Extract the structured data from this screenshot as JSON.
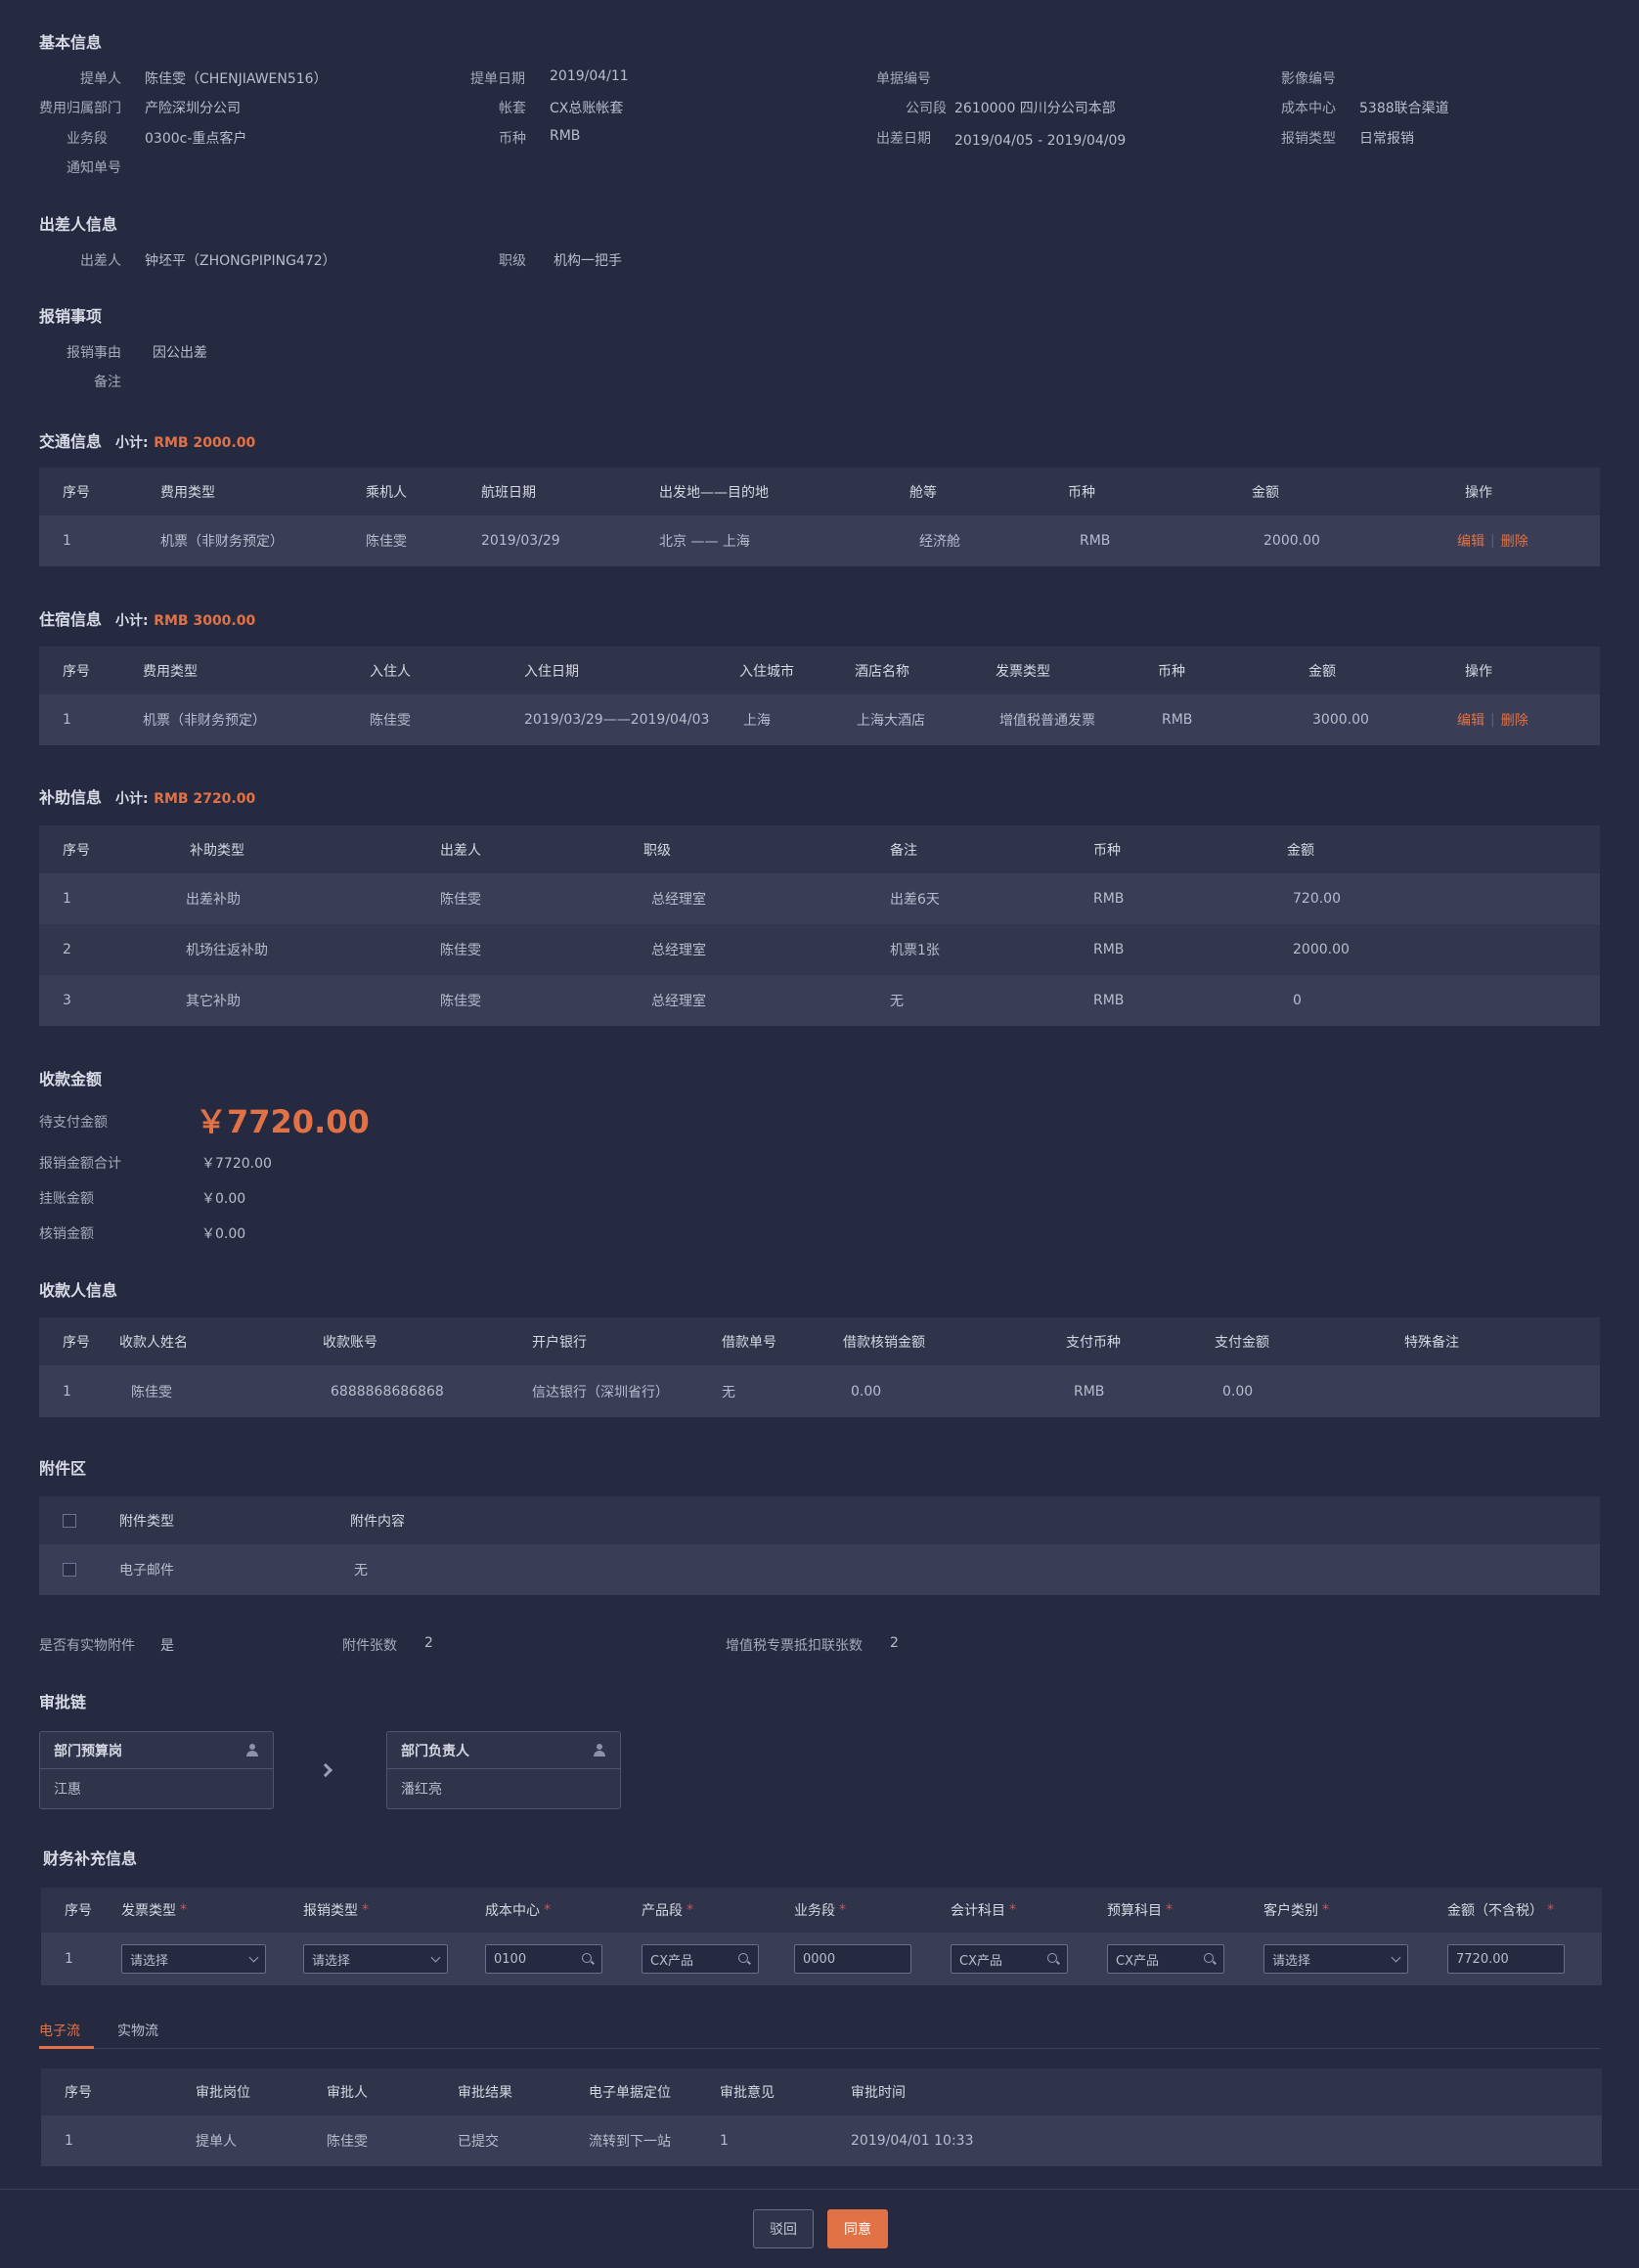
{
  "basic": {
    "title": "基本信息",
    "fields": [
      {
        "label": "提单人",
        "value": "陈佳雯（CHENJIAWEN516）"
      },
      {
        "label": "提单日期",
        "value": "2019/04/11"
      },
      {
        "label": "单据编号",
        "value": ""
      },
      {
        "label": "影像编号",
        "value": ""
      },
      {
        "label": "费用归属部门",
        "value": "产险深圳分公司"
      },
      {
        "label": "帐套",
        "value": "CX总账帐套"
      },
      {
        "label": "公司段",
        "value": "2610000 四川分公司本部"
      },
      {
        "label": "成本中心",
        "value": "5388联合渠道"
      },
      {
        "label": "业务段",
        "value": "0300c-重点客户"
      },
      {
        "label": "币种",
        "value": "RMB"
      },
      {
        "label": "出差日期",
        "value": "2019/04/05 - 2019/04/09"
      },
      {
        "label": "报销类型",
        "value": "日常报销"
      },
      {
        "label": "通知单号",
        "value": ""
      }
    ]
  },
  "traveler": {
    "title": "出差人信息",
    "name_label": "出差人",
    "name_value": "钟坯平（ZHONGPIPING472）",
    "level_label": "职级",
    "level_value": "机构一把手"
  },
  "reimb": {
    "title": "报销事项",
    "reason_label": "报销事由",
    "reason_value": "因公出差",
    "note_label": "备注",
    "note_value": ""
  },
  "transport": {
    "title": "交通信息",
    "subtotal_label": "小计:",
    "subtotal_value": "RMB 2000.00",
    "headers": [
      "序号",
      "费用类型",
      "乘机人",
      "航班日期",
      "出发地——目的地",
      "舱等",
      "币种",
      "金额",
      "操作"
    ],
    "rows": [
      [
        "1",
        "机票（非财务预定）",
        "陈佳雯",
        "2019/03/29",
        "北京 —— 上海",
        "经济舱",
        "RMB",
        "2000.00"
      ]
    ],
    "edit": "编辑",
    "delete": "删除",
    "sep": "|"
  },
  "lodging": {
    "title": "住宿信息",
    "subtotal_label": "小计:",
    "subtotal_value": "RMB 3000.00",
    "headers": [
      "序号",
      "费用类型",
      "入住人",
      "入住日期",
      "入住城市",
      "酒店名称",
      "发票类型",
      "币种",
      "金额",
      "操作"
    ],
    "rows": [
      [
        "1",
        "机票（非财务预定）",
        "陈佳雯",
        "2019/03/29——2019/04/03",
        "上海",
        "上海大酒店",
        "增值税普通发票",
        "RMB",
        "3000.00"
      ]
    ],
    "edit": "编辑",
    "delete": "删除",
    "sep": "|"
  },
  "subsidy": {
    "title": "补助信息",
    "subtotal_label": "小计:",
    "subtotal_value": "RMB 2720.00",
    "headers": [
      "序号",
      "补助类型",
      "出差人",
      "职级",
      "备注",
      "币种",
      "金额"
    ],
    "rows": [
      [
        "1",
        "出差补助",
        "陈佳雯",
        "总经理室",
        "出差6天",
        "RMB",
        "720.00"
      ],
      [
        "2",
        "机场往返补助",
        "陈佳雯",
        "总经理室",
        "机票1张",
        "RMB",
        "2000.00"
      ],
      [
        "3",
        "其它补助",
        "陈佳雯",
        "总经理室",
        "无",
        "RMB",
        "0"
      ]
    ]
  },
  "amount": {
    "title": "收款金额",
    "pending_label": "待支付金额",
    "pending_value": "￥7720.00",
    "total_label": "报销金额合计",
    "total_value": "￥7720.00",
    "hang_label": "挂账金额",
    "hang_value": "￥0.00",
    "writeoff_label": "核销金额",
    "writeoff_value": "￥0.00"
  },
  "payee": {
    "title": "收款人信息",
    "headers": [
      "序号",
      "收款人姓名",
      "收款账号",
      "开户银行",
      "借款单号",
      "借款核销金额",
      "支付币种",
      "支付金额",
      "特殊备注"
    ],
    "rows": [
      [
        "1",
        "陈佳雯",
        "6888868686868",
        "信达银行（深圳省行）",
        "无",
        "0.00",
        "RMB",
        "0.00",
        ""
      ]
    ]
  },
  "attach": {
    "title": "附件区",
    "headers": [
      "附件类型",
      "附件内容"
    ],
    "rows": [
      [
        "电子邮件",
        "无"
      ]
    ],
    "physical_label": "是否有实物附件",
    "physical_value": "是",
    "count_label": "附件张数",
    "count_value": "2",
    "vat_label": "增值税专票抵扣联张数",
    "vat_value": "2"
  },
  "approval": {
    "title": "审批链",
    "nodes": [
      {
        "role": "部门预算岗",
        "person": "江惠"
      },
      {
        "role": "部门负责人",
        "person": "潘红亮"
      }
    ]
  },
  "finance": {
    "title": "财务补充信息",
    "headers": [
      "序号",
      "发票类型",
      "报销类型",
      "成本中心",
      "产品段",
      "业务段",
      "会计科目",
      "预算科目",
      "客户类别",
      "金额（不含税）"
    ],
    "required_mark": "*",
    "row": {
      "index": "1",
      "invoice_type": "请选择",
      "reimb_type": "请选择",
      "cost_center": "0100",
      "product": "CX产品",
      "business": "0000",
      "account": "CX产品",
      "budget": "CX产品",
      "customer": "请选择",
      "amount": "7720.00"
    }
  },
  "flow": {
    "tabs": [
      "电子流",
      "实物流"
    ],
    "headers": [
      "序号",
      "审批岗位",
      "审批人",
      "审批结果",
      "电子单据定位",
      "审批意见",
      "审批时间"
    ],
    "rows": [
      [
        "1",
        "提单人",
        "陈佳雯",
        "已提交",
        "流转到下一站",
        "1",
        "2019/04/01  10:33"
      ]
    ]
  },
  "footer": {
    "reject": "驳回",
    "approve": "同意"
  },
  "colors": {
    "background": "#262a40",
    "accent": "#e07246",
    "table_header": "#30344a",
    "table_row": "#393d55"
  }
}
